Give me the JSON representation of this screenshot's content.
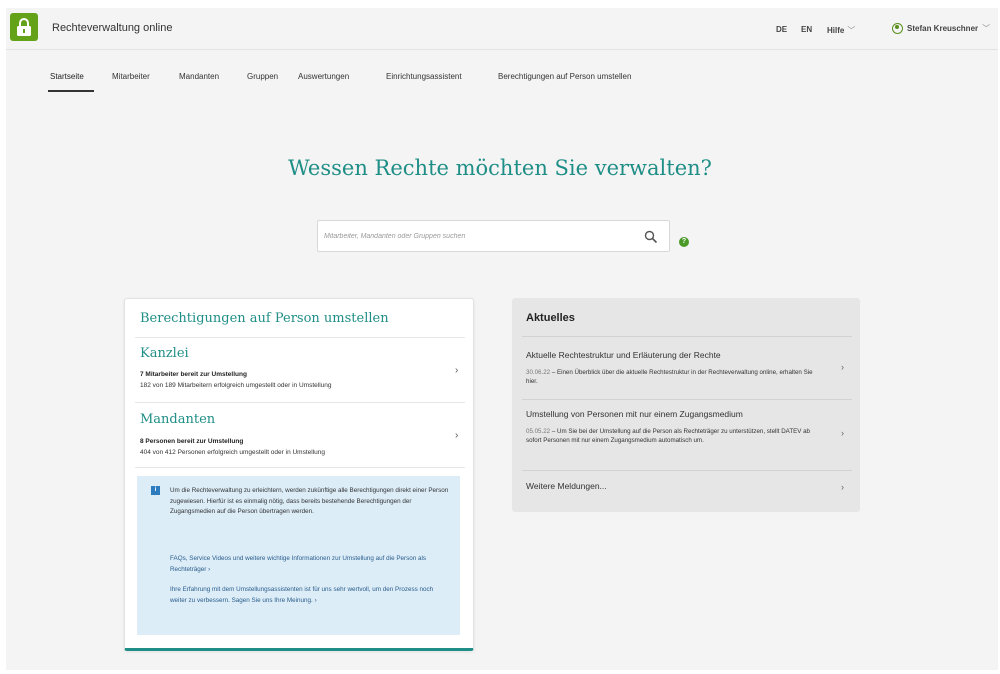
{
  "header": {
    "app_title": "Rechteverwaltung online",
    "lang_de": "DE",
    "lang_en": "EN",
    "help": "Hilfe",
    "user": "Stefan Kreuschner",
    "logo_icon": "padlock-icon",
    "brand_color": "#64a21a"
  },
  "nav": {
    "items": [
      "Startseite",
      "Mitarbeiter",
      "Mandanten",
      "Gruppen",
      "Auswertungen",
      "Einrichtungsassistent",
      "Berechtigungen auf Person umstellen"
    ],
    "active": "Startseite"
  },
  "main": {
    "headline": "Wessen Rechte möchten Sie verwalten?",
    "search_placeholder": "Mitarbeiter, Mandanten oder Gruppen suchen",
    "accent_color": "#1f8e86"
  },
  "left_card": {
    "title": "Berechtigungen auf Person umstellen",
    "sections": [
      {
        "title": "Kanzlei",
        "bold": "7 Mitarbeiter bereit zur Umstellung",
        "sub": "182 von 189 Mitarbeitern erfolgreich umgestellt oder in Umstellung"
      },
      {
        "title": "Mandanten",
        "bold": "8 Personen bereit zur Umstellung",
        "sub": "404 von 412 Personen erfolgreich umgestellt oder in Umstellung"
      }
    ],
    "info": {
      "text": "Um die Rechteverwaltung zu erleichtern, werden zukünftige alle Berechtigungen direkt einer Person zugewiesen. Hierfür ist es einmalig nötig, dass bereits bestehende Berechtigungen der Zugangsmedien auf die Person übertragen werden.",
      "link1": "FAQs, Service Videos und weitere wichtige Informationen zur Umstellung auf die Person als Rechteträger",
      "link2": "Ihre Erfahrung mit dem Umstellungsassistenten ist für uns sehr wertvoll, um den Prozess noch weiter zu verbessern. Sagen Sie uns Ihre Meinung."
    }
  },
  "right_card": {
    "title": "Aktuelles",
    "items": [
      {
        "head": "Aktuelle Rechtestruktur und Erläuterung der Rechte",
        "date": "30.06.22",
        "body": " – Einen Überblick über die aktuelle Rechtestruktur in der Rechteverwaltung online, erhalten Sie hier."
      },
      {
        "head": "Umstellung von Personen mit nur einem Zugangsmedium",
        "date": "05.05.22",
        "body": " – Um Sie bei der Umstellung auf die Person als Rechteträger zu unterstützen, stellt DATEV ab sofort Personen mit nur einem Zugangsmedium automatisch um."
      }
    ],
    "more": "Weitere Meldungen..."
  }
}
